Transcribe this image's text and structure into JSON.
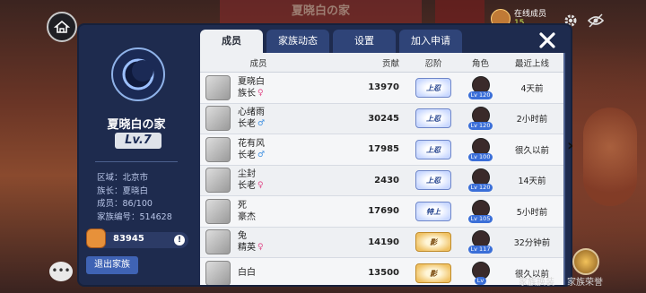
{
  "background": {
    "banner_title": "夏晓白の家"
  },
  "topbar": {
    "online": {
      "label": "在线成员",
      "count": "15"
    },
    "icons": [
      "home-icon",
      "gear-icon",
      "eye-icon"
    ]
  },
  "clan": {
    "name": "夏晓白の家",
    "level": "Lv.7",
    "info": {
      "region": "区域：北京市",
      "leader": "族长：夏晓白",
      "members": "成员：86/100",
      "id": "家族编号：514628"
    },
    "fund": "83945",
    "leave_label": "退出家族"
  },
  "tabs": [
    {
      "label": "成员",
      "active": true
    },
    {
      "label": "家族动态",
      "active": false
    },
    {
      "label": "设置",
      "active": false
    },
    {
      "label": "加入申请",
      "active": false
    }
  ],
  "table": {
    "headers": [
      "成员",
      "贡献",
      "忍阶",
      "角色",
      "最近上线"
    ],
    "rows": [
      {
        "name": "夏晓白",
        "position": "族长",
        "sex": "♀",
        "contribution": "13970",
        "rank": "上忍",
        "rank_style": "blue",
        "role_level": "Lv 120",
        "last_online": "4天前"
      },
      {
        "name": "心绪雨",
        "position": "长老",
        "sex": "♂",
        "contribution": "30245",
        "rank": "上忍",
        "rank_style": "blue",
        "role_level": "Lv 120",
        "last_online": "2小时前"
      },
      {
        "name": "花有风",
        "position": "长老",
        "sex": "♂",
        "contribution": "17985",
        "rank": "上忍",
        "rank_style": "blue",
        "role_level": "Lv 100",
        "last_online": "很久以前"
      },
      {
        "name": "尘封",
        "position": "长老",
        "sex": "♀",
        "contribution": "2430",
        "rank": "上忍",
        "rank_style": "blue",
        "role_level": "Lv 120",
        "last_online": "14天前"
      },
      {
        "name": "死",
        "position": "豪杰",
        "sex": "",
        "contribution": "17690",
        "rank": "特上",
        "rank_style": "blue",
        "role_level": "Lv 105",
        "last_online": "5小时前"
      },
      {
        "name": "兔",
        "position": "精英",
        "sex": "♀",
        "contribution": "14190",
        "rank": "影",
        "rank_style": "gold",
        "role_level": "Lv 117",
        "last_online": "32分钟前"
      },
      {
        "name": "白白",
        "position": "",
        "sex": "",
        "contribution": "13500",
        "rank": "影",
        "rank_style": "gold",
        "role_level": "Lv",
        "last_online": "很久以前"
      }
    ]
  },
  "bottom": {
    "swap_label": "家族换装",
    "honor_label": "家族荣誉"
  },
  "colors": {
    "panel": "#1e2b4e",
    "tab_active": "#eef0f3",
    "tab_inactive": "#2f4478",
    "female": "#e0508c",
    "male": "#3f8fe0"
  }
}
